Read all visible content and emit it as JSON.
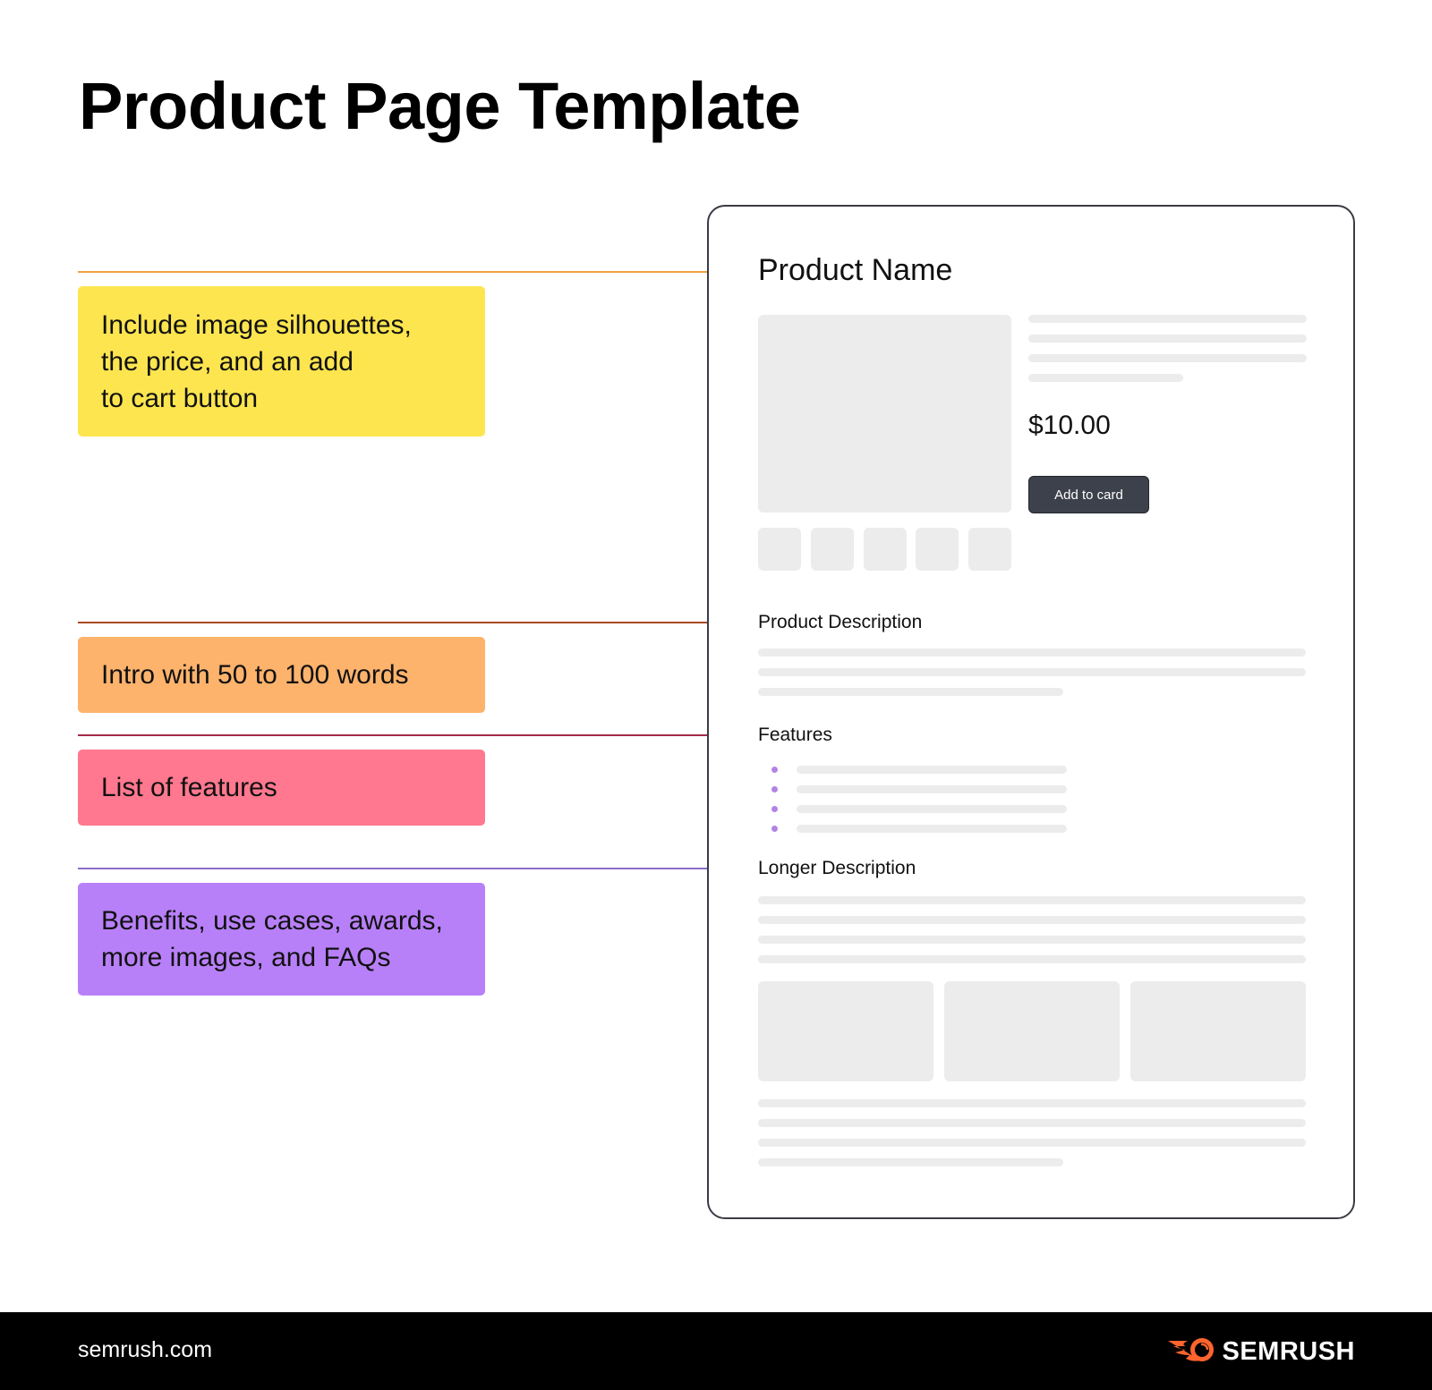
{
  "title": "Product Page Template",
  "colors": {
    "yellow_note": "#fde54f",
    "orange_note": "#fdb36c",
    "pink_note": "#ff788f",
    "purple_note": "#b880f8",
    "connector_orange": "#f3a13f",
    "connector_rust": "#a94a24",
    "connector_crimson": "#a52a48",
    "connector_violet": "#8e6dc8",
    "dot_orange": "#f39312",
    "dot_rust": "#a33a10",
    "dot_crimson": "#a21c3f",
    "dot_violet": "#6b34d3",
    "button_bg": "#3d414b",
    "brand_orange": "#ff642d"
  },
  "annotations": [
    {
      "id": "product-name",
      "text": "Include image silhouettes,\nthe price, and an add\nto cart button"
    },
    {
      "id": "product-description",
      "text": "Intro with 50 to 100 words"
    },
    {
      "id": "features",
      "text": "List of features"
    },
    {
      "id": "longer-description",
      "text": "Benefits, use cases, awards,\nmore images, and FAQs"
    }
  ],
  "mockup": {
    "product_name": "Product Name",
    "price": "$10.00",
    "add_button_label": "Add to card",
    "sections": {
      "description": "Product Description",
      "features": "Features",
      "longer": "Longer Description"
    },
    "thumbnail_count": 5,
    "feature_bullet_count": 4,
    "gallery_image_count": 3
  },
  "footer": {
    "site": "semrush.com",
    "brand": "SEMRUSH",
    "brand_icon": "semrush-fireball-icon"
  }
}
